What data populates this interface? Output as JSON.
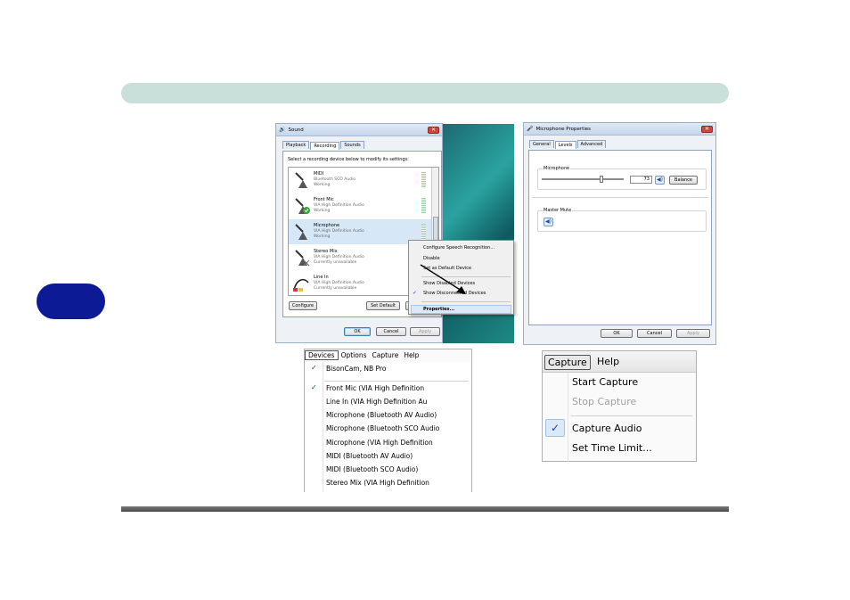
{
  "sound_dialog": {
    "title": "Sound",
    "tabs": [
      "Playback",
      "Recording",
      "Sounds"
    ],
    "active_tab": "Recording",
    "instruction": "Select a recording device below to modify its settings:",
    "devices": [
      {
        "name": "MIDI",
        "driver": "Bluetooth SCO Audio",
        "status": "Working"
      },
      {
        "name": "Front Mic",
        "driver": "VIA High Definition Audio",
        "status": "Working"
      },
      {
        "name": "Microphone",
        "driver": "VIA High Definition Audio",
        "status": "Working"
      },
      {
        "name": "Stereo Mix",
        "driver": "VIA High Definition Audio",
        "status": "Currently unavailable"
      },
      {
        "name": "Line In",
        "driver": "VIA High Definition Audio",
        "status": "Currently unavailable"
      }
    ],
    "buttons": {
      "configure": "Configure",
      "set_default": "Set Default",
      "properties": "P",
      "ok": "OK",
      "cancel": "Cancel",
      "apply": "Apply"
    }
  },
  "context_menu": {
    "items": [
      "Configure Speech Recognition...",
      "Disable",
      "Set as Default Device",
      "Show Disabled Devices",
      "Show Disconnected Devices",
      "Properties..."
    ],
    "checked": "Show Disconnected Devices",
    "highlighted": "Properties..."
  },
  "mic_properties": {
    "title": "Microphone Properties",
    "tabs": [
      "General",
      "Levels",
      "Advanced"
    ],
    "active_tab": "Levels",
    "group_microphone": "Microphone",
    "volume_value": "73",
    "volume_level": 0.73,
    "balance_label": "Balance",
    "group_master_mute": "Master Mute",
    "buttons": {
      "ok": "OK",
      "cancel": "Cancel",
      "apply": "Apply"
    }
  },
  "devices_menu": {
    "menubar": [
      "Devices",
      "Options",
      "Capture",
      "Help"
    ],
    "items": [
      {
        "label": "BisonCam, NB Pro",
        "checked": true
      },
      {
        "label": "Front Mic (VIA High Definition",
        "checked": true
      },
      {
        "label": "Line In (VIA High Definition Au",
        "checked": false
      },
      {
        "label": "Microphone (Bluetooth AV Audio)",
        "checked": false
      },
      {
        "label": "Microphone (Bluetooth SCO Audio",
        "checked": false
      },
      {
        "label": "Microphone (VIA High Definition",
        "checked": false
      },
      {
        "label": "MIDI (Bluetooth AV Audio)",
        "checked": false
      },
      {
        "label": "MIDI (Bluetooth SCO Audio)",
        "checked": false
      },
      {
        "label": "Stereo Mix (VIA High Definition",
        "checked": false
      }
    ],
    "check_glyph": "✓"
  },
  "capture_menu": {
    "menubar": [
      "Capture",
      "Help"
    ],
    "items": [
      {
        "label": "Start Capture",
        "enabled": true,
        "checked": false
      },
      {
        "label": "Stop Capture",
        "enabled": false,
        "checked": false
      },
      {
        "label": "Capture Audio",
        "enabled": true,
        "checked": true
      },
      {
        "label": "Set Time Limit...",
        "enabled": true,
        "checked": false
      }
    ],
    "check_glyph": "✓"
  },
  "colors": {
    "header_bar": "#c9dfd9",
    "chapter_tab": "#0d1a96",
    "menu_check": "#1c3fa5"
  }
}
